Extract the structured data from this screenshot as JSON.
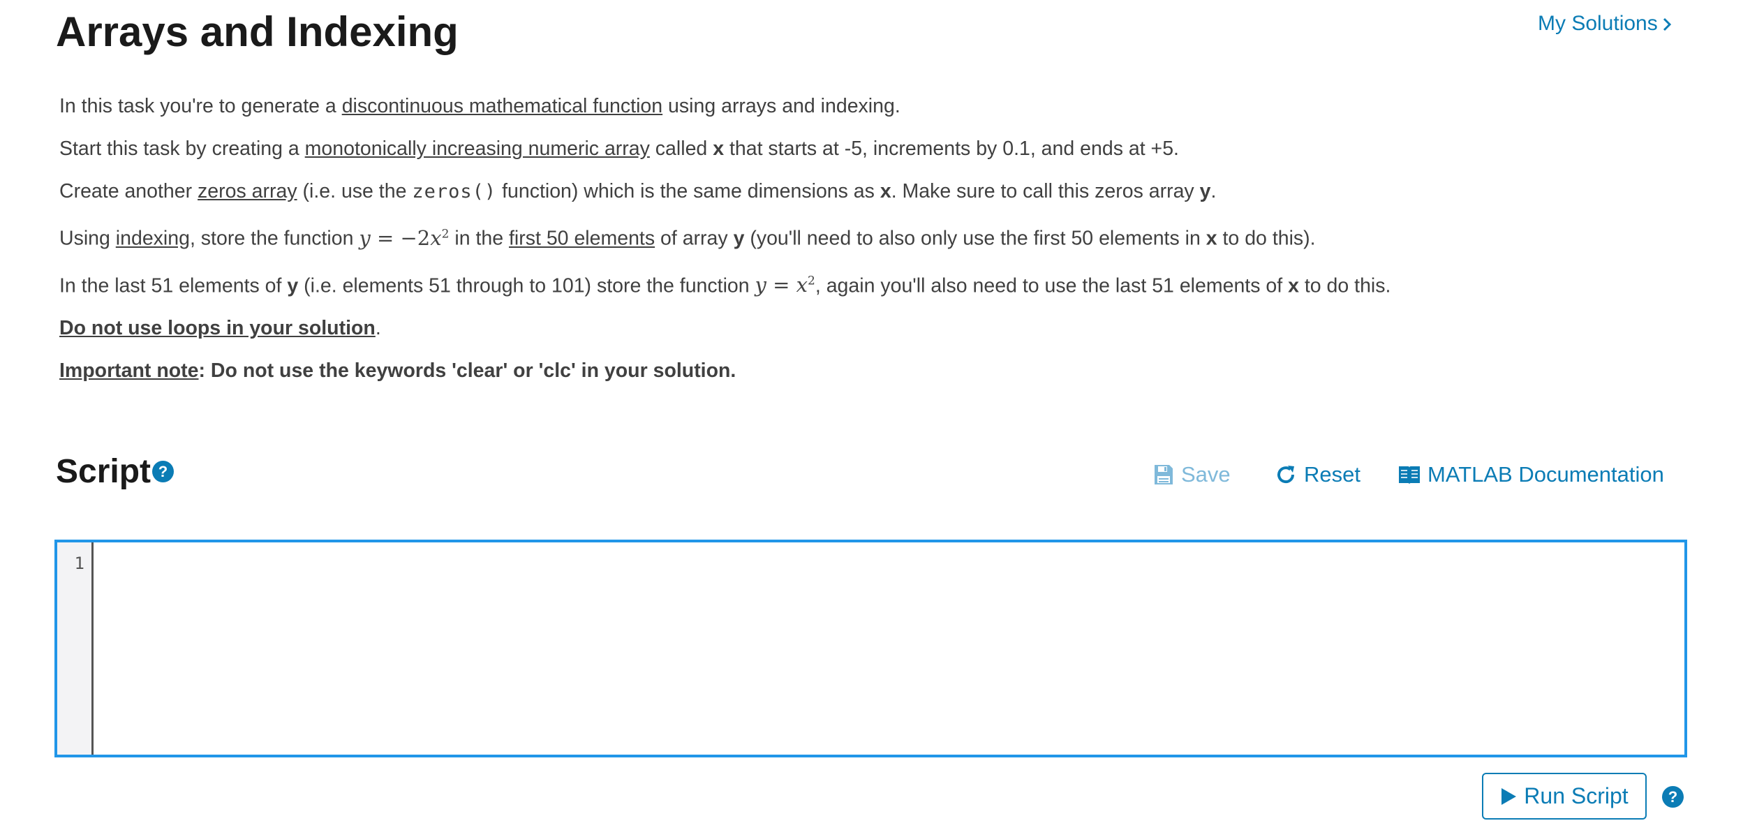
{
  "header": {
    "title": "Arrays and Indexing",
    "my_solutions_label": "My Solutions"
  },
  "description": {
    "p1": {
      "before": "In this task you're to generate a ",
      "link": "discontinuous mathematical function",
      "after": " using arrays and indexing."
    },
    "p2": {
      "before": "Start this task by creating a ",
      "link": "monotonically increasing numeric array",
      "mid": " called ",
      "var": "x",
      "after": " that starts at -5, increments by 0.1, and ends at +5."
    },
    "p3": {
      "before": "Create another ",
      "link": "zeros array",
      "mid": " (i.e. use the ",
      "code": "zeros()",
      "mid2": " function) which is the same dimensions as ",
      "var_x": "x",
      "mid3": ". Make sure to call this zeros array ",
      "var_y": "y",
      "after": "."
    },
    "p4": {
      "before": "Using ",
      "link1": "indexing",
      "mid1": ", store the function ",
      "math_lhs": "y",
      "math_eq": " = −2",
      "math_var": "x",
      "math_exp": "2",
      "mid2": " in the ",
      "link2": "first 50 elements",
      "mid3": " of array ",
      "var_y": "y",
      "mid4": " (you'll need to also only use the first 50 elements in ",
      "var_x": "x",
      "after": " to do this)."
    },
    "p5": {
      "before": "In the last 51 elements of ",
      "var_y": "y",
      "mid1": " (i.e. elements 51 through to 101) store the function ",
      "math_lhs": "y",
      "math_eq": " = ",
      "math_var": "x",
      "math_exp": "2",
      "mid2": ", again you'll also need to use the last 51 elements of ",
      "var_x": "x",
      "after": " to do this."
    },
    "p6": {
      "underlined": "Do not use loops in your solution",
      "after": "."
    },
    "p7": {
      "underlined": "Important note",
      "after": ": Do not use the keywords 'clear' or 'clc' in your solution."
    }
  },
  "script_section": {
    "title": "Script",
    "help_glyph": "?",
    "toolbar": {
      "save_label": "Save",
      "reset_label": "Reset",
      "docs_label": "MATLAB Documentation"
    },
    "editor": {
      "line_numbers": [
        "1"
      ],
      "code": ""
    },
    "run_label": "Run Script"
  },
  "icons": {
    "help": "question-circle-icon",
    "save": "floppy-disk-icon",
    "reset": "refresh-icon",
    "docs": "book-icon",
    "run": "play-icon",
    "my_solutions": "chevron-right-icon"
  },
  "colors": {
    "accent": "#0b7cb5",
    "accent_disabled": "#7fb9da",
    "editor_border": "#2196e8",
    "text": "#404040",
    "heading": "#1a1a1a"
  }
}
